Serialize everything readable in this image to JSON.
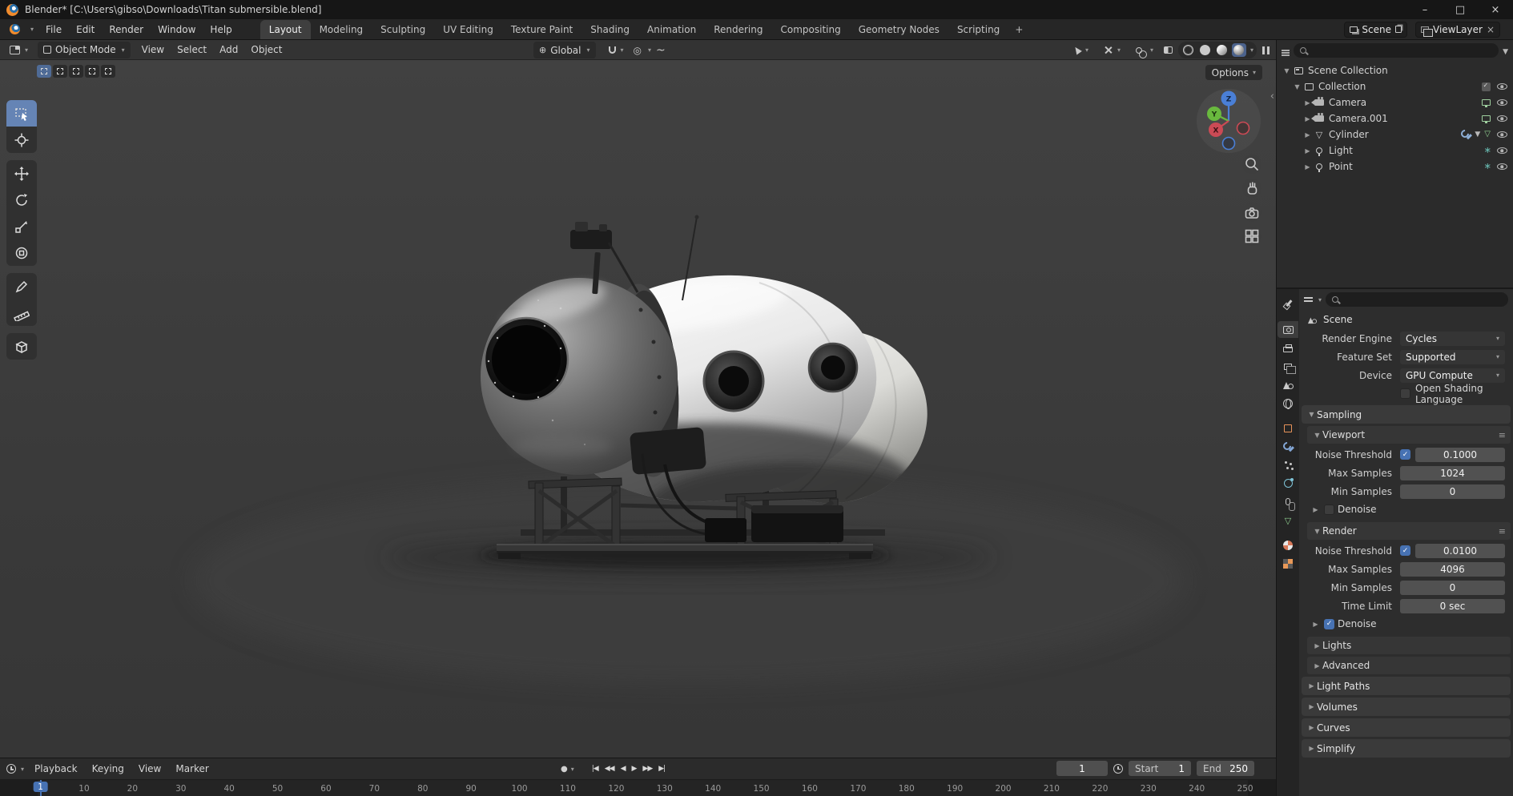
{
  "titlebar": {
    "title": "Blender* [C:\\Users\\gibso\\Downloads\\Titan submersible.blend]"
  },
  "glyphs": {
    "caret": "▾",
    "disc_open": "▼",
    "disc_closed": "▶",
    "check": "✓",
    "record": "●",
    "panel_menu": "≡",
    "minimize": "–",
    "maximize": "□",
    "close": "×",
    "collapse": "‹",
    "orientation": "⊕",
    "prop_edit": "◎",
    "falloff": "~",
    "add": "+"
  },
  "topbar": {
    "menus": [
      "File",
      "Edit",
      "Render",
      "Window",
      "Help"
    ],
    "workspaces": [
      {
        "label": "Layout",
        "active": true
      },
      {
        "label": "Modeling"
      },
      {
        "label": "Sculpting"
      },
      {
        "label": "UV Editing"
      },
      {
        "label": "Texture Paint"
      },
      {
        "label": "Shading"
      },
      {
        "label": "Animation"
      },
      {
        "label": "Rendering"
      },
      {
        "label": "Compositing"
      },
      {
        "label": "Geometry Nodes"
      },
      {
        "label": "Scripting"
      }
    ],
    "add_workspace": "+",
    "scene": "Scene",
    "view_layer": "ViewLayer"
  },
  "viewport": {
    "header": {
      "mode": "Object Mode",
      "menus": [
        "View",
        "Select",
        "Add",
        "Object"
      ],
      "orientation": "Global",
      "options": "Options"
    },
    "gizmo": {
      "x": "X",
      "y": "Y",
      "z": "Z"
    }
  },
  "outliner": {
    "items": [
      {
        "label": "Scene Collection",
        "icon": "scene-collection",
        "depth": 0,
        "disclosure": "open",
        "badges": [],
        "eye": false
      },
      {
        "label": "Collection",
        "icon": "collection",
        "depth": 1,
        "disclosure": "open",
        "badges": [
          "checkbox"
        ],
        "eye": true
      },
      {
        "label": "Camera",
        "icon": "camera",
        "depth": 2,
        "disclosure": "closed",
        "badges": [
          "screen"
        ],
        "eye": true
      },
      {
        "label": "Camera.001",
        "icon": "camera",
        "depth": 2,
        "disclosure": "closed",
        "badges": [
          "screen"
        ],
        "eye": true
      },
      {
        "label": "Cylinder",
        "icon": "mesh",
        "depth": 2,
        "disclosure": "closed",
        "badges": [
          "wrench",
          "funnel",
          "mesh-data"
        ],
        "eye": true
      },
      {
        "label": "Light",
        "icon": "light",
        "depth": 2,
        "disclosure": "closed",
        "badges": [
          "light-data"
        ],
        "eye": true
      },
      {
        "label": "Point",
        "icon": "light",
        "depth": 2,
        "disclosure": "closed",
        "badges": [
          "light-data"
        ],
        "eye": true
      }
    ]
  },
  "properties": {
    "breadcrumb": "Scene",
    "render_engine_label": "Render Engine",
    "render_engine": "Cycles",
    "feature_set_label": "Feature Set",
    "feature_set": "Supported",
    "device_label": "Device",
    "device": "GPU Compute",
    "osl_label": "Open Shading Language",
    "sampling": {
      "title": "Sampling",
      "viewport": {
        "title": "Viewport",
        "noise_threshold_label": "Noise Threshold",
        "noise_threshold": "0.1000",
        "max_samples_label": "Max Samples",
        "max_samples": "1024",
        "min_samples_label": "Min Samples",
        "min_samples": "0",
        "denoise_label": "Denoise"
      },
      "render": {
        "title": "Render",
        "noise_threshold_label": "Noise Threshold",
        "noise_threshold": "0.0100",
        "max_samples_label": "Max Samples",
        "max_samples": "4096",
        "min_samples_label": "Min Samples",
        "min_samples": "0",
        "time_limit_label": "Time Limit",
        "time_limit": "0 sec",
        "denoise_label": "Denoise"
      },
      "lights_label": "Lights",
      "advanced_label": "Advanced"
    },
    "collapsed_panels": [
      "Light Paths",
      "Volumes",
      "Curves",
      "Simplify"
    ]
  },
  "timeline": {
    "menus": [
      "Playback",
      "Keying",
      "View",
      "Marker"
    ],
    "transport": [
      "|◀",
      "◀◀",
      "◀",
      "▶",
      "▶▶",
      "▶|"
    ],
    "current_frame": "1",
    "start_label": "Start",
    "start_value": "1",
    "end_label": "End",
    "end_value": "250",
    "ticks": [
      10,
      20,
      30,
      40,
      50,
      60,
      70,
      80,
      90,
      100,
      110,
      120,
      130,
      140,
      150,
      160,
      170,
      180,
      190,
      200,
      210,
      220,
      230,
      240,
      250
    ]
  }
}
